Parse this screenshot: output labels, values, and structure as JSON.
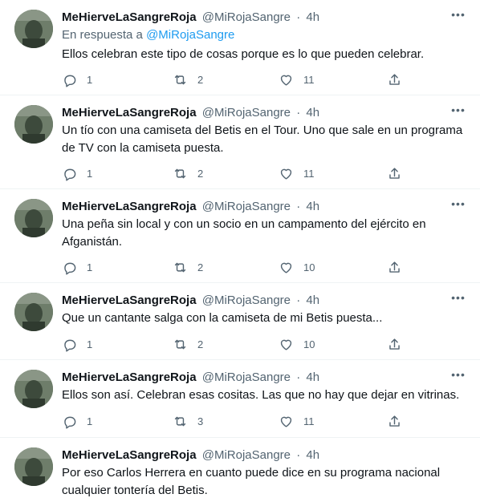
{
  "reply_prefix": "En respuesta a",
  "reply_handle": "@MiRojaSangre",
  "tweets": [
    {
      "name": "MeHierveLaSangreRoja",
      "handle": "@MiRojaSangre",
      "sep": "·",
      "time": "4h",
      "text": "Ellos celebran este tipo de cosas porque es lo que pueden celebrar.",
      "replies": "1",
      "retweets": "2",
      "likes": "11"
    },
    {
      "name": "MeHierveLaSangreRoja",
      "handle": "@MiRojaSangre",
      "sep": "·",
      "time": "4h",
      "text": "Un tío con una camiseta del Betis en el Tour. Uno que sale en un programa de TV con la camiseta puesta.",
      "replies": "1",
      "retweets": "2",
      "likes": "11"
    },
    {
      "name": "MeHierveLaSangreRoja",
      "handle": "@MiRojaSangre",
      "sep": "·",
      "time": "4h",
      "text": "Una peña sin local y con un socio en un campamento del ejército en Afganistán.",
      "replies": "1",
      "retweets": "2",
      "likes": "10"
    },
    {
      "name": "MeHierveLaSangreRoja",
      "handle": "@MiRojaSangre",
      "sep": "·",
      "time": "4h",
      "text": "Que un cantante salga con la camiseta de mi Betis puesta...",
      "replies": "1",
      "retweets": "2",
      "likes": "10"
    },
    {
      "name": "MeHierveLaSangreRoja",
      "handle": "@MiRojaSangre",
      "sep": "·",
      "time": "4h",
      "text": "Ellos son así. Celebran esas cositas. Las que no hay que dejar en vitrinas.",
      "replies": "1",
      "retweets": "3",
      "likes": "11"
    },
    {
      "name": "MeHierveLaSangreRoja",
      "handle": "@MiRojaSangre",
      "sep": "·",
      "time": "4h",
      "text": "Por eso Carlos Herrera en cuanto puede dice en su programa nacional cualquier tontería del Betis.",
      "replies": "",
      "retweets": "",
      "likes": ""
    }
  ],
  "colors": {
    "text": "#0f1419",
    "muted": "#536471",
    "link": "#1d9bf0",
    "border": "#eff3f4"
  },
  "icons": [
    "reply-icon",
    "retweet-icon",
    "like-icon",
    "share-icon",
    "more-icon"
  ]
}
